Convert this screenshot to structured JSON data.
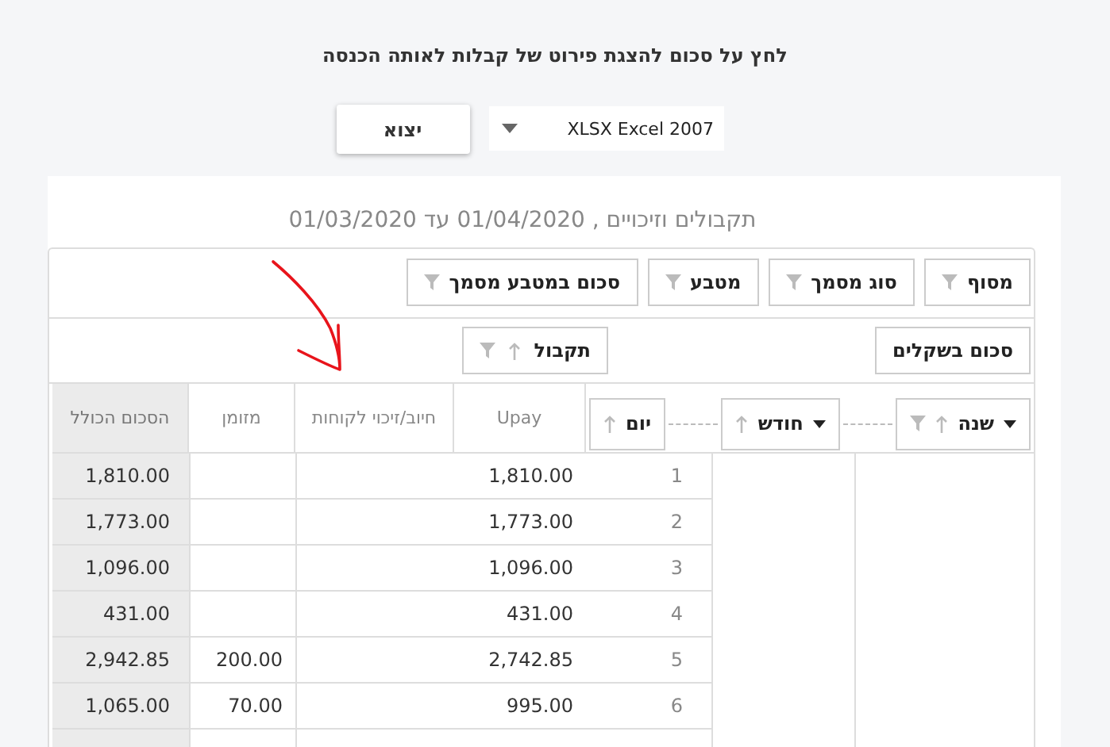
{
  "instruction": "לחץ על סכום להצגת פירוט של קבלות לאותה הכנסה",
  "export": {
    "button": "יצוא",
    "format": "XLSX Excel 2007"
  },
  "report_title": "תקבולים וזיכויים , 01/04/2020 עד 01/03/2020",
  "pivot": {
    "filter_fields": [
      {
        "label": "מסוף",
        "filter": true
      },
      {
        "label": "סוג מסמך",
        "filter": true
      },
      {
        "label": "מטבע",
        "filter": true
      },
      {
        "label": "סכום במטבע מסמך",
        "filter": true
      }
    ],
    "data_field": {
      "label": "סכום בשקלים"
    },
    "column_field": {
      "label": "תקבול",
      "sort": true,
      "filter": true
    },
    "row_fields": [
      {
        "label": "שנה",
        "caret": true,
        "sort": true,
        "filter": true
      },
      {
        "label": "חודש",
        "caret": true,
        "sort": true,
        "filter": false
      },
      {
        "label": "יום",
        "caret": false,
        "sort": true,
        "filter": false
      }
    ],
    "columns": [
      {
        "label": "Upay",
        "kind": "value"
      },
      {
        "label": "חיוב/זיכוי לקוחות",
        "kind": "value"
      },
      {
        "label": "מזומן",
        "kind": "value"
      },
      {
        "label": "הסכום הכולל",
        "kind": "total"
      }
    ],
    "rows": [
      {
        "day": "1",
        "upay": "1,810.00",
        "total": "1,810.00"
      },
      {
        "day": "2",
        "upay": "1,773.00",
        "total": "1,773.00"
      },
      {
        "day": "3",
        "upay": "1,096.00",
        "total": "1,096.00"
      },
      {
        "day": "4",
        "upay": "431.00",
        "total": "431.00"
      },
      {
        "day": "5",
        "upay": "2,742.85",
        "cash": "200.00",
        "total": "2,942.85"
      },
      {
        "day": "6",
        "upay": "995.00",
        "cash": "70.00",
        "total": "1,065.00"
      }
    ]
  }
}
